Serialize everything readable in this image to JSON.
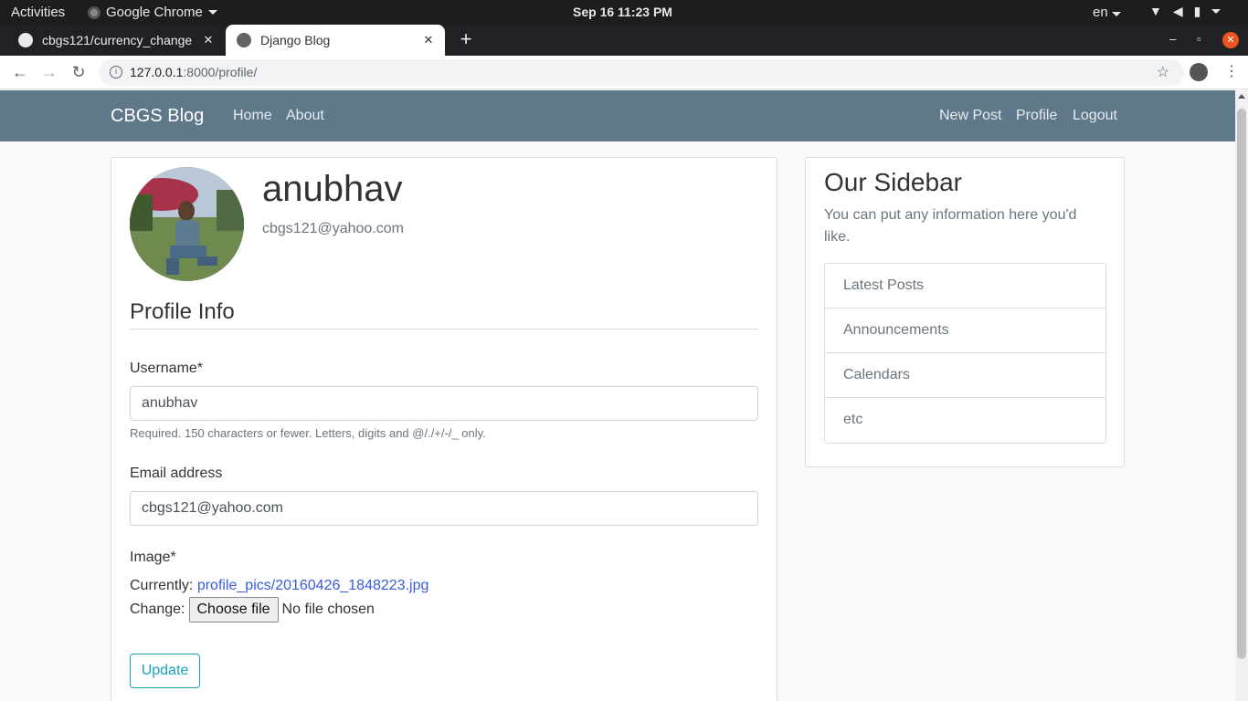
{
  "system_bar": {
    "activities": "Activities",
    "app_name": "Google Chrome",
    "clock": "Sep 16  11:23 PM",
    "language": "en"
  },
  "browser": {
    "tabs": [
      {
        "title": "cbgs121/currency_change",
        "active": false
      },
      {
        "title": "Django Blog",
        "active": true
      }
    ],
    "url_host": "127.0.0.1",
    "url_path": ":8000/profile/"
  },
  "site": {
    "brand": "CBGS Blog",
    "nav_left": [
      "Home",
      "About"
    ],
    "nav_right": [
      "New Post",
      "Profile",
      "Logout"
    ],
    "nav_color": "#5f788a"
  },
  "profile": {
    "username": "anubhav",
    "email": "cbgs121@yahoo.com"
  },
  "form": {
    "legend": "Profile Info",
    "username_label": "Username*",
    "username_value": "anubhav",
    "username_help": "Required. 150 characters or fewer. Letters, digits and @/./+/-/_ only.",
    "email_label": "Email address",
    "email_value": "cbgs121@yahoo.com",
    "image_label": "Image*",
    "currently_label": "Currently:",
    "current_file": "profile_pics/20160426_1848223.jpg",
    "change_label": "Change:",
    "choose_file": "Choose file",
    "no_file": "No file chosen",
    "submit": "Update"
  },
  "sidebar": {
    "title": "Our Sidebar",
    "text": "You can put any information here you'd like.",
    "items": [
      "Latest Posts",
      "Announcements",
      "Calendars",
      "etc"
    ]
  }
}
